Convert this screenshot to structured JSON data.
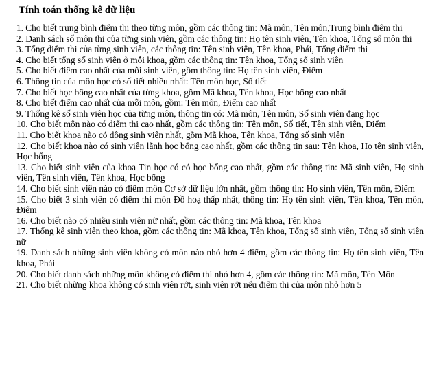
{
  "document": {
    "title": "Tính toán thống kê dữ liệu",
    "background_color": "#ffffff",
    "text_color": "#000000",
    "items": [
      {
        "number": "1.",
        "text": "1. Cho biết trung bình điểm thi theo từng môn, gồm các thông tin: Mã môn, Tên môn,Trung bình điểm thi"
      },
      {
        "number": "2.",
        "text": "2. Danh sách số môn thi của từng sinh viên, gồm các thông tin: Họ tên sinh viên, Tên khoa, Tổng số môn thi"
      },
      {
        "number": "3.",
        "text": "3. Tổng điểm thi của từng sinh viên, các thông tin: Tên sinh viên, Tên khoa, Phái, Tổng điểm thi"
      },
      {
        "number": "4.",
        "text": "4. Cho biết tổng số sinh viên ở mỗi khoa, gồm các thông tin: Tên khoa, Tổng số sinh viên"
      },
      {
        "number": "5.",
        "text": "5. Cho biết điểm cao nhất của mỗi sinh viên, gồm thông tin: Họ tên sinh viên, Điểm"
      },
      {
        "number": "6.",
        "text": "6. Thông tin của môn học có số tiết nhiều nhất: Tên môn học, Số tiết"
      },
      {
        "number": "7.",
        "text": "7. Cho biết học bổng cao nhất của từng khoa, gồm Mã khoa, Tên khoa, Học bổng cao nhất"
      },
      {
        "number": "8.",
        "text": "8. Cho biết điểm cao nhất của mỗi môn, gồm: Tên môn, Điểm cao nhất"
      },
      {
        "number": "9.",
        "text": "9. Thống kê số sinh viên học của từng môn, thông tin có: Mã môn, Tên môn, Số sinh viên đang học"
      },
      {
        "number": "10.",
        "text": "10. Cho biết môn nào có điểm thi cao nhất, gồm các thông tin: Tên môn, Số tiết, Tên sinh viên, Điểm"
      },
      {
        "number": "11.",
        "text": "11. Cho biết khoa nào có đông sinh viên nhất, gồm Mã khoa, Tên khoa, Tổng số sinh viên"
      },
      {
        "number": "12.",
        "text": "12. Cho biết khoa nào có sinh viên lãnh học bổng cao nhất, gồm các thông tin sau: Tên khoa, Họ tên sinh viên, Học bổng"
      },
      {
        "number": "13.",
        "text": "13. Cho biết sinh viên của khoa Tin học có có học bổng cao nhất, gồm các thông tin: Mã sinh viên, Họ sinh viên, Tên sinh viên, Tên khoa, Học bổng"
      },
      {
        "number": "14.",
        "text": "14. Cho biết sinh viên nào có điểm môn Cơ sở dữ liệu lớn nhất, gồm thông tin: Họ sinh viên, Tên môn, Điểm"
      },
      {
        "number": "15.",
        "text": "15. Cho biết 3 sinh viên có điểm thi môn Đồ hoạ thấp nhất, thông tin: Họ tên sinh viên, Tên khoa, Tên môn, Điểm"
      },
      {
        "number": "16.",
        "text": "16. Cho biết nào có nhiều sinh viên nữ nhất, gồm các thông tin: Mã khoa, Tên khoa"
      },
      {
        "number": "17.",
        "text": "17. Thống kê sinh viên theo khoa, gồm các thông tin: Mã khoa, Tên khoa, Tổng số sinh viên, Tổng số sinh viên nữ"
      },
      {
        "number": "19.",
        "text": "19. Danh sách những sinh viên không có môn nào nhỏ hơn 4 điểm, gồm các thông tin: Họ tên sinh viên, Tên khoa, Phái"
      },
      {
        "number": "20.",
        "text": "20. Cho biết danh sách những môn không có điểm thi nhỏ hơn 4, gồm các thông tin: Mã môn, Tên Môn"
      },
      {
        "number": "21.",
        "text": "21. Cho biết những khoa không có sinh viên rớt, sinh viên rớt nếu điểm thi của môn nhỏ hơn 5"
      }
    ]
  }
}
